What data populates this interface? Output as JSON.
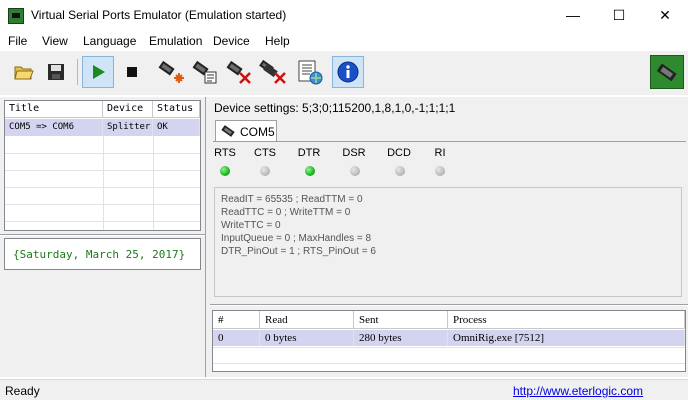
{
  "window": {
    "title": "Virtual Serial Ports Emulator (Emulation started)",
    "minimize": "—",
    "maximize": "☐",
    "close": "✕"
  },
  "menu": [
    "File",
    "View",
    "Language",
    "Emulation",
    "Device",
    "Help"
  ],
  "toolbar": {
    "icons": [
      "open-folder-icon",
      "save-icon",
      "play-icon",
      "stop-icon",
      "new-device-icon",
      "device-properties-icon",
      "remove-device-icon",
      "remove-all-devices-icon",
      "log-icon",
      "info-icon",
      "serial-connector-icon"
    ]
  },
  "devices_grid": {
    "columns": [
      "Title",
      "Device",
      "Status"
    ],
    "rows": [
      {
        "title": "COM5 => COM6",
        "device": "Splitter",
        "status": "OK"
      }
    ]
  },
  "date_display": "{Saturday, March 25, 2017}",
  "device_settings": "Device settings: 5;3;0;115200,1,8,1,0,-1;1;1;1",
  "tab": {
    "label": "COM5"
  },
  "pins": [
    {
      "label": "RTS",
      "state": "on"
    },
    {
      "label": "CTS",
      "state": "off"
    },
    {
      "label": "DTR",
      "state": "on"
    },
    {
      "label": "DSR",
      "state": "off"
    },
    {
      "label": "DCD",
      "state": "off"
    },
    {
      "label": "RI",
      "state": "off"
    }
  ],
  "info_lines": [
    "ReadIT = 65535 ; ReadTTM = 0",
    "ReadTTC = 0 ; WriteTTM = 0",
    "WriteTTC = 0",
    "InputQueue = 0 ; MaxHandles = 8",
    "DTR_PinOut = 1 ; RTS_PinOut = 6"
  ],
  "process_grid": {
    "columns": [
      "#",
      "Read",
      "Sent",
      "Process"
    ],
    "rows": [
      {
        "num": "0",
        "read": "0 bytes",
        "sent": "280 bytes",
        "process": "OmniRig.exe [7512]"
      }
    ]
  },
  "status": {
    "text": "Ready",
    "link": "http://www.eterlogic.com"
  },
  "colors": {
    "led_on": "#1fb51f",
    "led_off": "#bdbdbd",
    "selected_row": "#d4d4f0",
    "date_text": "#1a7a1a",
    "link": "#0000e0"
  }
}
